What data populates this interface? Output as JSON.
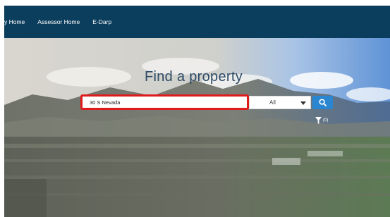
{
  "nav": {
    "items": [
      "y Home",
      "Assessor Home",
      "E-Darp"
    ]
  },
  "hero": {
    "title": "Find a property"
  },
  "search": {
    "value": "30 S Nevada"
  },
  "filter_select": {
    "selected": "All"
  },
  "filter": {
    "count": "(0)"
  },
  "icons": {
    "search_button": "search-icon",
    "filter": "filter-icon",
    "dropdown": "caret-down-icon"
  },
  "colors": {
    "nav_bg": "#0b3d5c",
    "title": "#2d4a66",
    "search_highlight": "#e01b1b",
    "search_button": "#2a86d1"
  }
}
